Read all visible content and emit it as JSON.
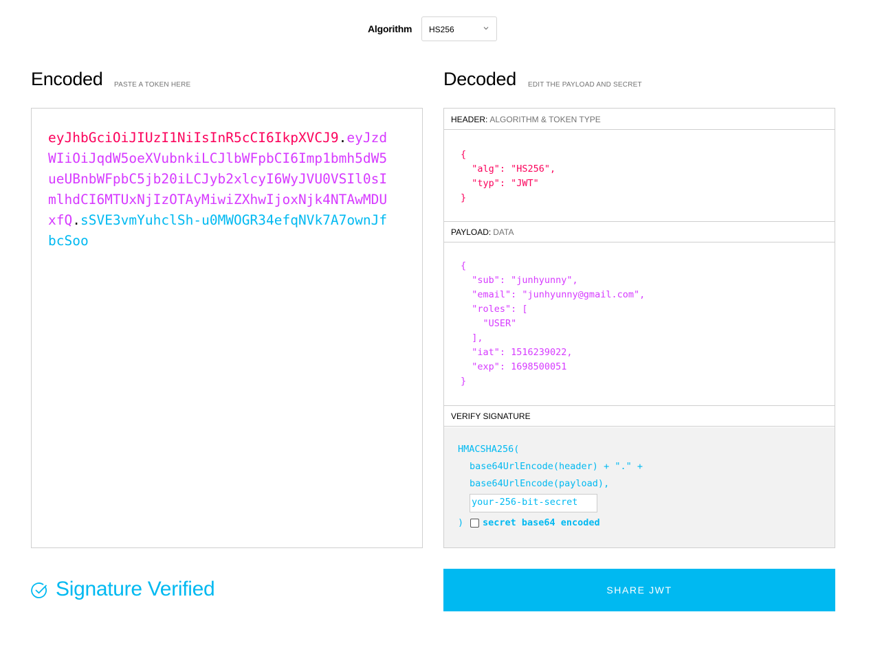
{
  "algorithm": {
    "label": "Algorithm",
    "selected": "HS256"
  },
  "encoded": {
    "title": "Encoded",
    "subtitle": "PASTE A TOKEN HERE",
    "token": {
      "header": "eyJhbGciOiJIUzI1NiIsInR5cCI6IkpXVCJ9",
      "dot1": ".",
      "payload": "eyJzdWIiOiJqdW5oeXVubnkiLCJlbWFpbCI6Imp1bmh5dW5ueUBnbWFpbC5jb20iLCJyb2xlcyI6WyJVU0VSIl0sImlhdCI6MTUxNjIzOTAyMiwiZXhwIjoxNjk4NTAwMDUxfQ",
      "dot2": ".",
      "signature": "sSVE3vmYuhclSh-u0MWOGR34efqNVk7A7ownJfbcSoo"
    }
  },
  "decoded": {
    "title": "Decoded",
    "subtitle": "EDIT THE PAYLOAD AND SECRET",
    "header_section": {
      "label": "HEADER:",
      "sub": "ALGORITHM & TOKEN TYPE"
    },
    "header_json": "{\n  \"alg\": \"HS256\",\n  \"typ\": \"JWT\"\n}",
    "payload_section": {
      "label": "PAYLOAD:",
      "sub": "DATA"
    },
    "payload_json": "{\n  \"sub\": \"junhyunny\",\n  \"email\": \"junhyunny@gmail.com\",\n  \"roles\": [\n    \"USER\"\n  ],\n  \"iat\": 1516239022,\n  \"exp\": 1698500051\n}",
    "signature_section": {
      "label": "VERIFY SIGNATURE"
    },
    "signature": {
      "line1": "HMACSHA256(",
      "line2": "base64UrlEncode(header) + \".\" +",
      "line3": "base64UrlEncode(payload),",
      "secret_value": "your-256-bit-secret",
      "close": ")",
      "base64_label": "secret base64 encoded",
      "base64_checked": false
    }
  },
  "status": {
    "text": "Signature Verified",
    "icon": "check-circle-icon"
  },
  "share_button": {
    "label": "SHARE JWT"
  },
  "colors": {
    "header": "#fb015b",
    "payload": "#d63aff",
    "signature": "#00b9f1"
  }
}
